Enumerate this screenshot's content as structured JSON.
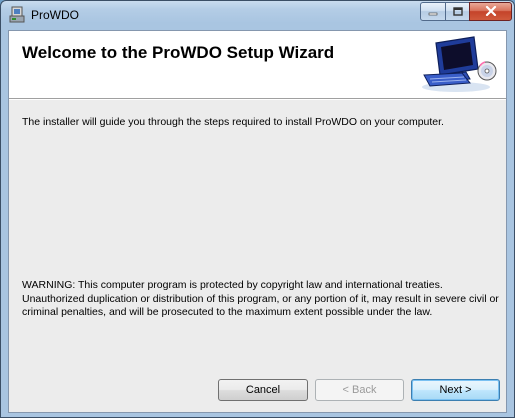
{
  "window": {
    "title": "ProWDO",
    "icons": {
      "app": "installer-icon",
      "minimize": "minimize-icon",
      "maximize": "maximize-icon",
      "close": "close-icon"
    }
  },
  "banner": {
    "title": "Welcome to the ProWDO Setup Wizard",
    "art": "computer-with-disc-icon"
  },
  "body": {
    "intro": "The installer will guide you through the steps required to install ProWDO on your computer.",
    "warning": "WARNING: This computer program is protected by copyright law and international treaties. Unauthorized duplication or distribution of this program, or any portion of it, may result in severe civil or criminal penalties, and will be prosecuted to the maximum extent possible under the law."
  },
  "buttons": {
    "cancel": "Cancel",
    "back": "< Back",
    "next": "Next >"
  }
}
